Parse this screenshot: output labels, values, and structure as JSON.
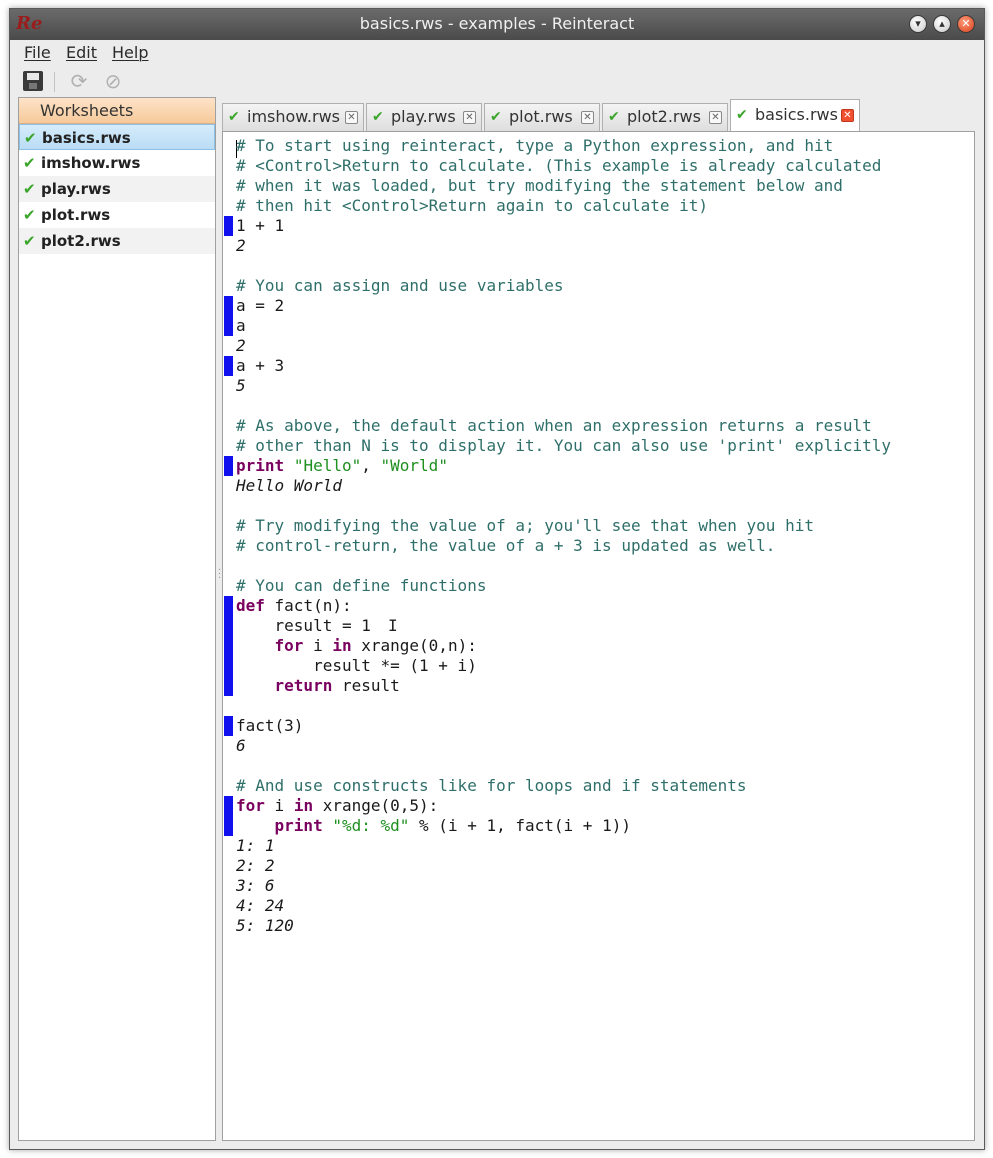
{
  "window": {
    "title": "basics.rws - examples - Reinteract",
    "logo_text": "Re",
    "controls": {
      "minimize": "▾",
      "maximize": "▴",
      "close": "✕"
    }
  },
  "menu": {
    "file": "File",
    "edit": "Edit",
    "help": "Help"
  },
  "toolbar": {
    "save_icon": "save-icon",
    "refresh_icon": "⟳",
    "stop_icon": "⊘"
  },
  "sidebar": {
    "header": "Worksheets",
    "items": [
      {
        "label": "basics.rws",
        "status": "✔"
      },
      {
        "label": "imshow.rws",
        "status": "✔"
      },
      {
        "label": "play.rws",
        "status": "✔"
      },
      {
        "label": "plot.rws",
        "status": "✔"
      },
      {
        "label": "plot2.rws",
        "status": "✔"
      }
    ]
  },
  "tabs": [
    {
      "label": "imshow.rws",
      "status": "✔",
      "close": "✕"
    },
    {
      "label": "play.rws",
      "status": "✔",
      "close": "✕"
    },
    {
      "label": "plot.rws",
      "status": "✔",
      "close": "✕"
    },
    {
      "label": "plot2.rws",
      "status": "✔",
      "close": "✕"
    },
    {
      "label": "basics.rws",
      "status": "✔",
      "close": "✕"
    }
  ],
  "editor": {
    "lines": [
      "# To start using reinteract, type a Python expression, and hit",
      "# <Control>Return to calculate. (This example is already calculated",
      "# when it was loaded, but try modifying the statement below and",
      "# then hit <Control>Return again to calculate it)",
      "1 + 1",
      "2",
      "",
      "# You can assign and use variables",
      "a = 2",
      "a",
      "2",
      "a + 3",
      "5",
      "",
      "# As above, the default action when an expression returns a result",
      "# other than N is to display it. You can also use 'print' explicitly",
      "print \"Hello\", \"World\"",
      "Hello World",
      "",
      "# Try modifying the value of a; you'll see that when you hit",
      "# control-return, the value of a + 3 is updated as well.",
      "",
      "# You can define functions",
      "def fact(n):",
      "    result = 1",
      "    for i in xrange(0,n):",
      "        result *= (1 + i)",
      "    return result",
      "",
      "fact(3)",
      "6",
      "",
      "# And use constructs like for loops and if statements",
      "for i in xrange(0,5):",
      "    print \"%d: %d\" % (i + 1, fact(i + 1))",
      "1: 1",
      "2: 2",
      "3: 6",
      "4: 24",
      "5: 120"
    ]
  }
}
